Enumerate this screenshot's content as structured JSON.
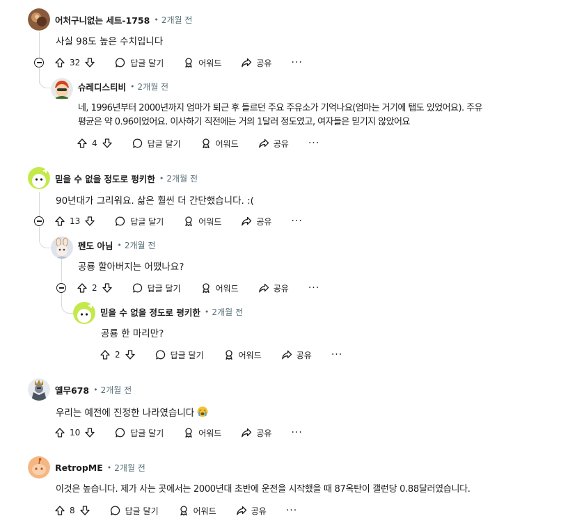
{
  "comments": [
    {
      "author": "어처구니없는 세트-1758",
      "time": "2개월 전",
      "body": "사실 98도 높은 수치입니다",
      "votes": "32"
    },
    {
      "author": "슈레디스티비",
      "time": "2개월 전",
      "body_lines": [
        "네, 1996년부터 2000년까지 엄마가 퇴근 후 들르던 주요 주유소가 기억나요(엄마는 거기에 탭도 있었어요). 주유",
        "평균은 약 0.96이었어요. 이사하기 직전에는 거의 1달러 정도였고, 여자들은 믿기지 않았어요"
      ],
      "votes": "4"
    },
    {
      "author": "믿을 수 없을 정도로 펑키한",
      "time": "2개월 전",
      "body": "90년대가 그리워요. 삶은 훨씬 더 간단했습니다. :(",
      "votes": "13"
    },
    {
      "author": "펜도 아님",
      "time": "2개월 전",
      "body": "공룡 할아버지는 어땠나요?",
      "votes": "2"
    },
    {
      "author": "믿을 수 없을 정도로 펑키한",
      "time": "2개월 전",
      "body": "공룡 한 마리만?",
      "votes": "2"
    },
    {
      "author": "옐무678",
      "time": "2개월 전",
      "body": "우리는 예전에 진정한 나라였습니다",
      "votes": "10"
    },
    {
      "author": "RetropME",
      "time": "2개월 전",
      "body": "이것은 높습니다. 제가 사는 곳에서는 2000년대 초반에 운전을 시작했을 때 87옥탄이 갤런당 0.88달러였습니다.",
      "votes": "8"
    }
  ],
  "labels": {
    "dot": "•",
    "reply": "답글 달기",
    "award": "어워드",
    "share": "공유",
    "more": "···"
  },
  "icons": {
    "upvote": "upvote-arrow-icon",
    "downvote": "downvote-arrow-icon",
    "reply": "speech-bubble-icon",
    "award": "award-ribbon-icon",
    "share": "share-arrow-icon",
    "collapse": "collapse-minus-icon",
    "crying_emoji": "crying-face-emoji-icon"
  },
  "colors": {
    "text": "#1c1c1c",
    "meta": "#576f76",
    "thread_line": "#d6dadd",
    "avatar_green": "#c3e94a",
    "avatar_orange": "#f6b682"
  }
}
